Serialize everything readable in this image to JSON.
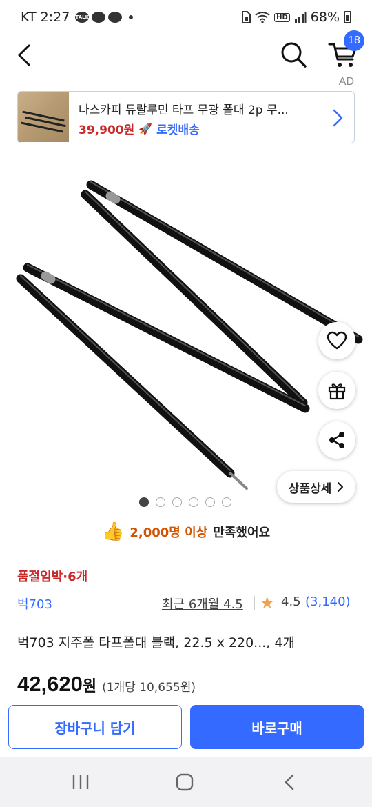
{
  "status_bar": {
    "carrier_time": "KT 2:27",
    "talk_label": "TALK",
    "hd_label": "HD",
    "battery": "68%"
  },
  "header": {
    "cart_count": "18"
  },
  "ad": {
    "label": "AD",
    "title": "나스카피 듀랄루민 타프 무광 폴대 2p 무...",
    "price": "39,900원",
    "delivery": "로켓배송"
  },
  "gallery": {
    "detail_button": "상품상세",
    "dot_count": 6,
    "active_index": 0
  },
  "satisfaction": {
    "count": "2,000명 이상",
    "text": "만족했어요"
  },
  "product": {
    "stock_warning": "품절임박·6개",
    "brand": "벅703",
    "recent_rating": "최근 6개월 4.5",
    "rating": "4.5",
    "review_count": "(3,140)",
    "title": "벅703 지주폴 타프폴대 블랙, 22.5 x 220..., 4개",
    "price": "42,620",
    "price_unit": "원",
    "unit_price": "(1개당 10,655원)"
  },
  "actions": {
    "add_to_cart": "장바구니 담기",
    "buy_now": "바로구매"
  },
  "colors": {
    "accent": "#346aff",
    "sale_red": "#c92a2a",
    "satisfaction_orange": "#d35400",
    "star": "#f5a04a"
  }
}
